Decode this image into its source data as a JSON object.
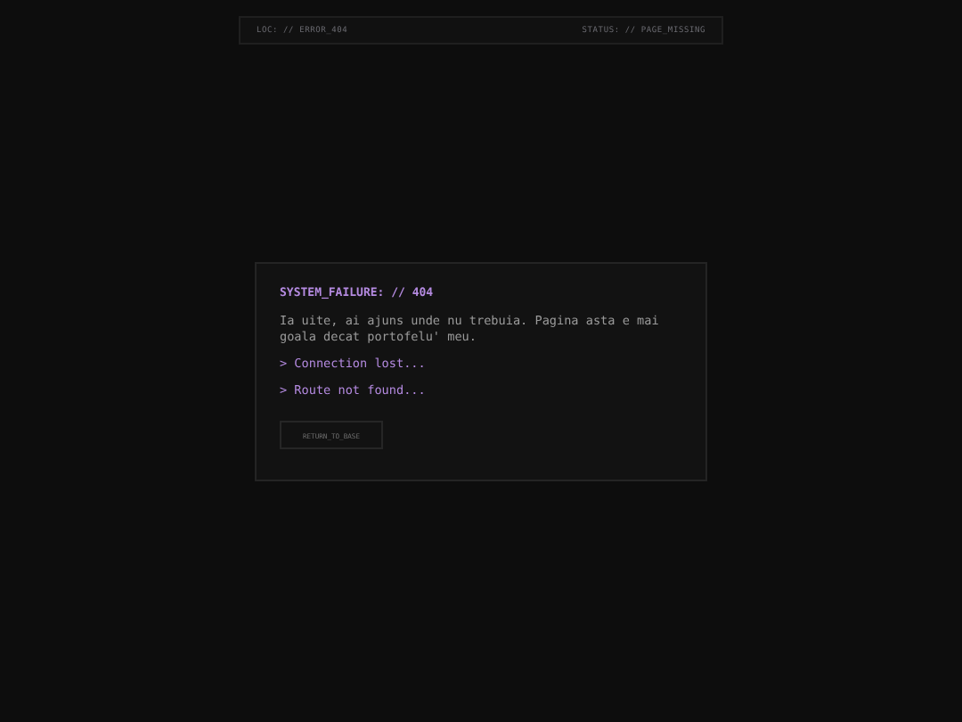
{
  "header": {
    "location": "LOC: // ERROR_404",
    "status": "STATUS: // PAGE_MISSING"
  },
  "card": {
    "title": "SYSTEM_FAILURE: // 404",
    "message": "Ia uite, ai ajuns unde nu trebuia. Pagina asta e mai goala decat portofelu' meu.",
    "log_lines": [
      "> Connection lost...",
      "> Route not found..."
    ],
    "button": "RETURN_TO_BASE"
  }
}
